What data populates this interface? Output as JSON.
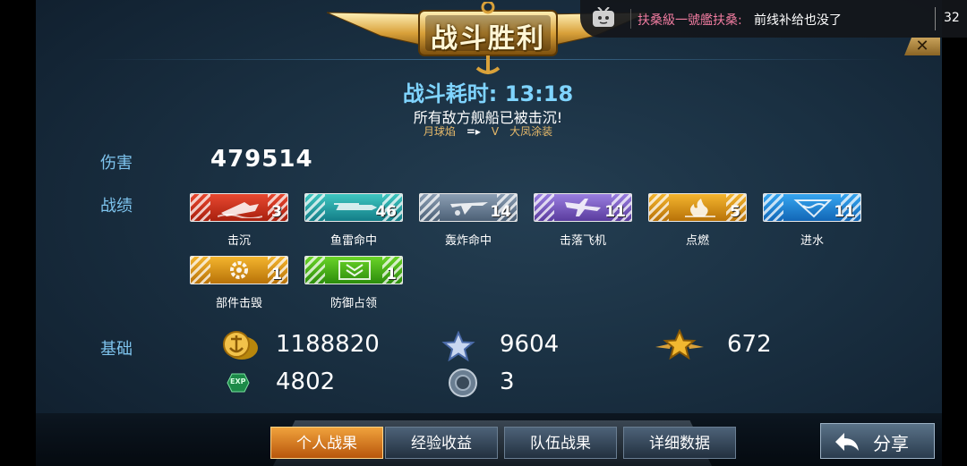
{
  "header": {
    "title": "战斗胜利",
    "battle_time_label": "战斗耗时:",
    "battle_time_value": "13:18",
    "result_message": "所有敌方舰船已被击沉!",
    "skin_from": "月球焰",
    "skin_arrow": "=▸",
    "skin_tag": "V",
    "skin_to": "大凤涂装"
  },
  "close_icon": "✕",
  "damage": {
    "label": "伤害",
    "value": "479514"
  },
  "achievements": {
    "label": "战绩",
    "items": [
      {
        "name": "击沉",
        "count": "3",
        "color": "#d83a22",
        "icon": "ship-sink-icon"
      },
      {
        "name": "鱼雷命中",
        "count": "46",
        "color": "#26a4a6",
        "icon": "torpedo-icon"
      },
      {
        "name": "轰炸命中",
        "count": "14",
        "color": "#6e8196",
        "icon": "bomber-icon"
      },
      {
        "name": "击落飞机",
        "count": "11",
        "color": "#7a5ec0",
        "icon": "plane-down-icon"
      },
      {
        "name": "点燃",
        "count": "5",
        "color": "#e0941a",
        "icon": "fire-icon"
      },
      {
        "name": "进水",
        "count": "11",
        "color": "#1e86d4",
        "icon": "flood-icon"
      },
      {
        "name": "部件击毁",
        "count": "1",
        "color": "#e0a020",
        "icon": "gear-icon"
      },
      {
        "name": "防御占领",
        "count": "1",
        "color": "#4cb81a",
        "icon": "chevron-shield-icon"
      }
    ]
  },
  "basics": {
    "label": "基础",
    "silver": "1188820",
    "free_xp": "9604",
    "captain_xp": "672",
    "exp": "4802",
    "exp_badge": "EXP",
    "flags": "3"
  },
  "tabs": [
    "个人战果",
    "经验收益",
    "队伍战果",
    "详细数据"
  ],
  "active_tab_index": 0,
  "share_label": "分享",
  "danmaku": {
    "user": "扶桑級一號艦扶桑:",
    "text": "前线补给也没了",
    "count": "32"
  }
}
